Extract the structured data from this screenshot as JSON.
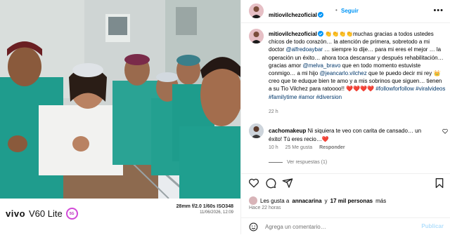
{
  "header": {
    "username": "mitiovilchezoficial",
    "separator": "•",
    "follow_label": "Seguir",
    "more_label": "•••"
  },
  "caption": {
    "username": "mitiovilchezoficial",
    "segments": [
      {
        "type": "text",
        "value": " 👏👏👏👏muchas gracias a todos ustedes chicos de todo corazón… la atención de primera, sobretodo a mi doctor "
      },
      {
        "type": "link",
        "value": "@alfredoaybar"
      },
      {
        "type": "text",
        "value": " … siempre lo dije… para mi eres el mejor … la operación un éxito… ahora toca descansar y después rehabilitación… gracias amor "
      },
      {
        "type": "link",
        "value": "@melva_bravo"
      },
      {
        "type": "text",
        "value": " que en todo momento estuviste conmigo… a mi hijo "
      },
      {
        "type": "link",
        "value": "@jeancarlo.vilchez"
      },
      {
        "type": "text",
        "value": " que te puedo decir mi rey 👑 creo que te eduque bien te amo y a mis sobrinos que siguen… tienen a su Tio Vilchez para ratoooo!! ❤️❤️❤️❤️ "
      },
      {
        "type": "link",
        "value": "#followforfollow #viralvideos #familytime #amor #diversion"
      }
    ],
    "time": "22 h"
  },
  "comment": {
    "username": "cachomakeup",
    "text": "Ni siquiera te veo con carita de cansado… un éxito! Tú eres recio…❤️",
    "time": "10 h",
    "likes": "25 Me gusta",
    "reply_label": "Responder",
    "view_replies": "Ver respuestas (1)"
  },
  "likes": {
    "prefix": "Les gusta a",
    "user": "annacarina",
    "middle": "y",
    "count": "17 mil personas",
    "suffix": "más"
  },
  "posted": "Hace 22 horas",
  "add_comment": {
    "placeholder": "Agrega un comentario…",
    "post_label": "Publicar"
  },
  "photo_watermark": {
    "brand": "vivo",
    "model": "V60 Lite",
    "badge": "5G",
    "specs": "28mm  f/2.0  1/60s  ISO348",
    "date": "11/06/2026, 12:09"
  },
  "icons": [
    "verified-badge-icon",
    "more-options-icon",
    "heart-icon",
    "comment-icon",
    "share-icon",
    "bookmark-icon",
    "emoji-icon",
    "small-heart-icon"
  ],
  "colors": {
    "accent": "#0095f6",
    "link": "#00376b",
    "heart": "#ed1c24",
    "secondary_text": "#737373"
  }
}
